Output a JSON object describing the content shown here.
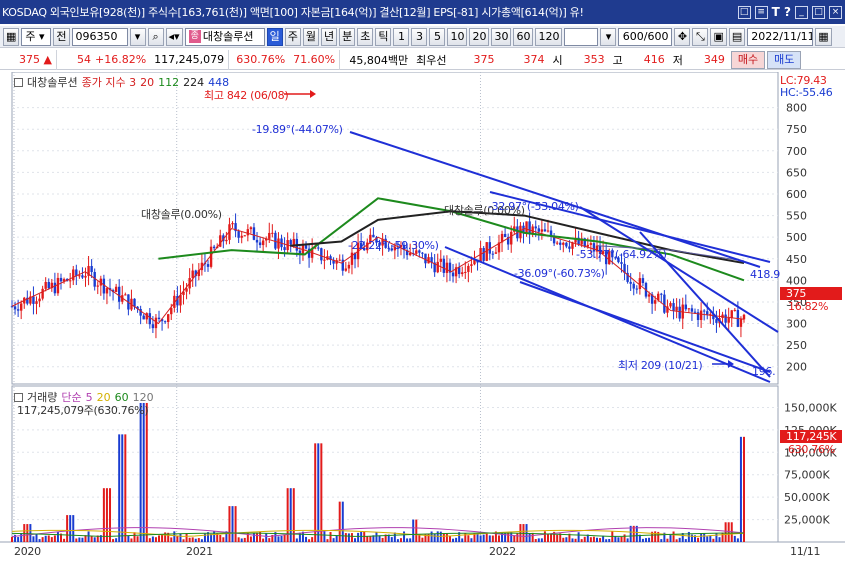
{
  "titlebar": {
    "title": "KOSDAQ 외국인보유[928(천)] 주식수[163,761(천)] 액면[100] 자본금[164(억)] 결산[12월] EPS[-81] 시가총액[614(억)] 유!",
    "trailing_text": "T ?"
  },
  "toolbar": {
    "market_label": "주",
    "prev_label": "전",
    "code_value": "096350",
    "stock_badge": "종",
    "stock_name": "대창솔루션",
    "periods": [
      "일",
      "주",
      "월",
      "년",
      "분",
      "초",
      "틱"
    ],
    "active_period": "일",
    "intervals": [
      "1",
      "3",
      "5",
      "10",
      "20",
      "30",
      "60",
      "120"
    ],
    "count_value": "600/600",
    "date_value": "2022/11/11"
  },
  "pricerow": {
    "price": "375",
    "change_arrow": "▲",
    "change": "54",
    "change_pct": "+16.82%",
    "volume": "117,245,079",
    "volume_pct": "630.76%",
    "turnover_pct": "71.60%",
    "amount": "45,804백만",
    "hoga_label": "최우선",
    "ask": "375",
    "bid": "374",
    "open_label": "시",
    "open": "353",
    "high_label": "고",
    "high": "416",
    "low_label": "저",
    "low": "349",
    "buy_label": "매수",
    "sell_label": "매도"
  },
  "price_panel": {
    "tag_label": "대창솔루션",
    "ma_label": "종가 지수 3",
    "ma_periods": [
      "20",
      "112",
      "224",
      "448"
    ],
    "lc_label": "LC:79.43",
    "hc_label": "HC:-55.46",
    "max_label": "최고 842 (06/08)",
    "min_label": "최저 209 (10/21)",
    "current_price": "375",
    "current_pct": "16.82%",
    "ann_top": "-19.89°(-44.07%)",
    "ann_mid_left": "-22.22°(-59.30%)",
    "ann_mid_right": "-32.97°(-53.04%)",
    "ann_lower": "-36.09°(-60.73%)",
    "ann_lower_right": "-53.77°(-64.92%)",
    "ann_flat_left": "대창솔루(0.00%)",
    "ann_flat_mid": "대창솔루(0.00%)",
    "ann_4189": "418.9",
    "ann_196": "196."
  },
  "volume_panel": {
    "tag_label": "거래량",
    "ma_label": "단순",
    "ma_periods": [
      "5",
      "20",
      "60",
      "120"
    ],
    "latest_label": "117,245,079주(630.76%)",
    "current_value": "117,245K",
    "current_pct": "630.76%"
  },
  "xaxis": {
    "labels": [
      "2020",
      "2021",
      "2022"
    ],
    "date_label": "11/11"
  },
  "colors": {
    "up": "#e21b1b",
    "down": "#1a3cd1",
    "ma20": "#d42020",
    "ma112": "#1d8a1d",
    "ma224": "#222222",
    "ma448": "#5a5a9a",
    "trend": "#1f2fd6",
    "vol_ma5": "#b040b0",
    "vol_ma20": "#d4b000",
    "vol_ma60": "#1d8a1d"
  },
  "chart_data": [
    {
      "type": "candlestick",
      "title": "",
      "y_ticks": [
        200,
        250,
        300,
        350,
        400,
        450,
        500,
        550,
        600,
        650,
        700,
        750,
        800
      ],
      "ylim": [
        160,
        850
      ],
      "x_labels": [
        "2020",
        "2021",
        "2022"
      ],
      "max": {
        "value": 842,
        "date": "06/08"
      },
      "min": {
        "value": 209,
        "date": "10/21"
      },
      "last": {
        "value": 375,
        "change_pct": 16.82
      },
      "series": [
        {
          "name": "20",
          "x": [
            0,
            0.1,
            0.2,
            0.3,
            0.4,
            0.45,
            0.5,
            0.6,
            0.7,
            0.8,
            0.9,
            1.0
          ],
          "values": [
            340,
            420,
            300,
            520,
            470,
            440,
            500,
            420,
            520,
            470,
            330,
            310
          ]
        },
        {
          "name": "112",
          "x": [
            0.2,
            0.3,
            0.4,
            0.5,
            0.6,
            0.7,
            0.8,
            0.9,
            1.0
          ],
          "values": [
            450,
            470,
            460,
            590,
            560,
            510,
            490,
            460,
            400
          ]
        },
        {
          "name": "224",
          "x": [
            0.38,
            0.45,
            0.5,
            0.6,
            0.7,
            0.8,
            0.9,
            1.0
          ],
          "values": [
            480,
            490,
            540,
            560,
            550,
            510,
            470,
            440
          ]
        },
        {
          "name": "448",
          "x": [
            0.8,
            0.9,
            1.0
          ],
          "values": [
            480,
            470,
            445
          ]
        }
      ]
    },
    {
      "type": "bar",
      "title": "",
      "y_ticks": [
        "25,000K",
        "50,000K",
        "75,000K",
        "100,000K",
        "125,000K",
        "150,000K"
      ],
      "ylim": [
        0,
        165000
      ],
      "series": [
        {
          "name": "거래량",
          "x": [
            0.02,
            0.08,
            0.13,
            0.15,
            0.18,
            0.3,
            0.38,
            0.42,
            0.45,
            0.55,
            0.7,
            0.85,
            0.98,
            1.0
          ],
          "values": [
            20000,
            30000,
            60000,
            120000,
            155000,
            40000,
            60000,
            110000,
            45000,
            25000,
            20000,
            18000,
            22000,
            117245
          ]
        }
      ]
    }
  ]
}
